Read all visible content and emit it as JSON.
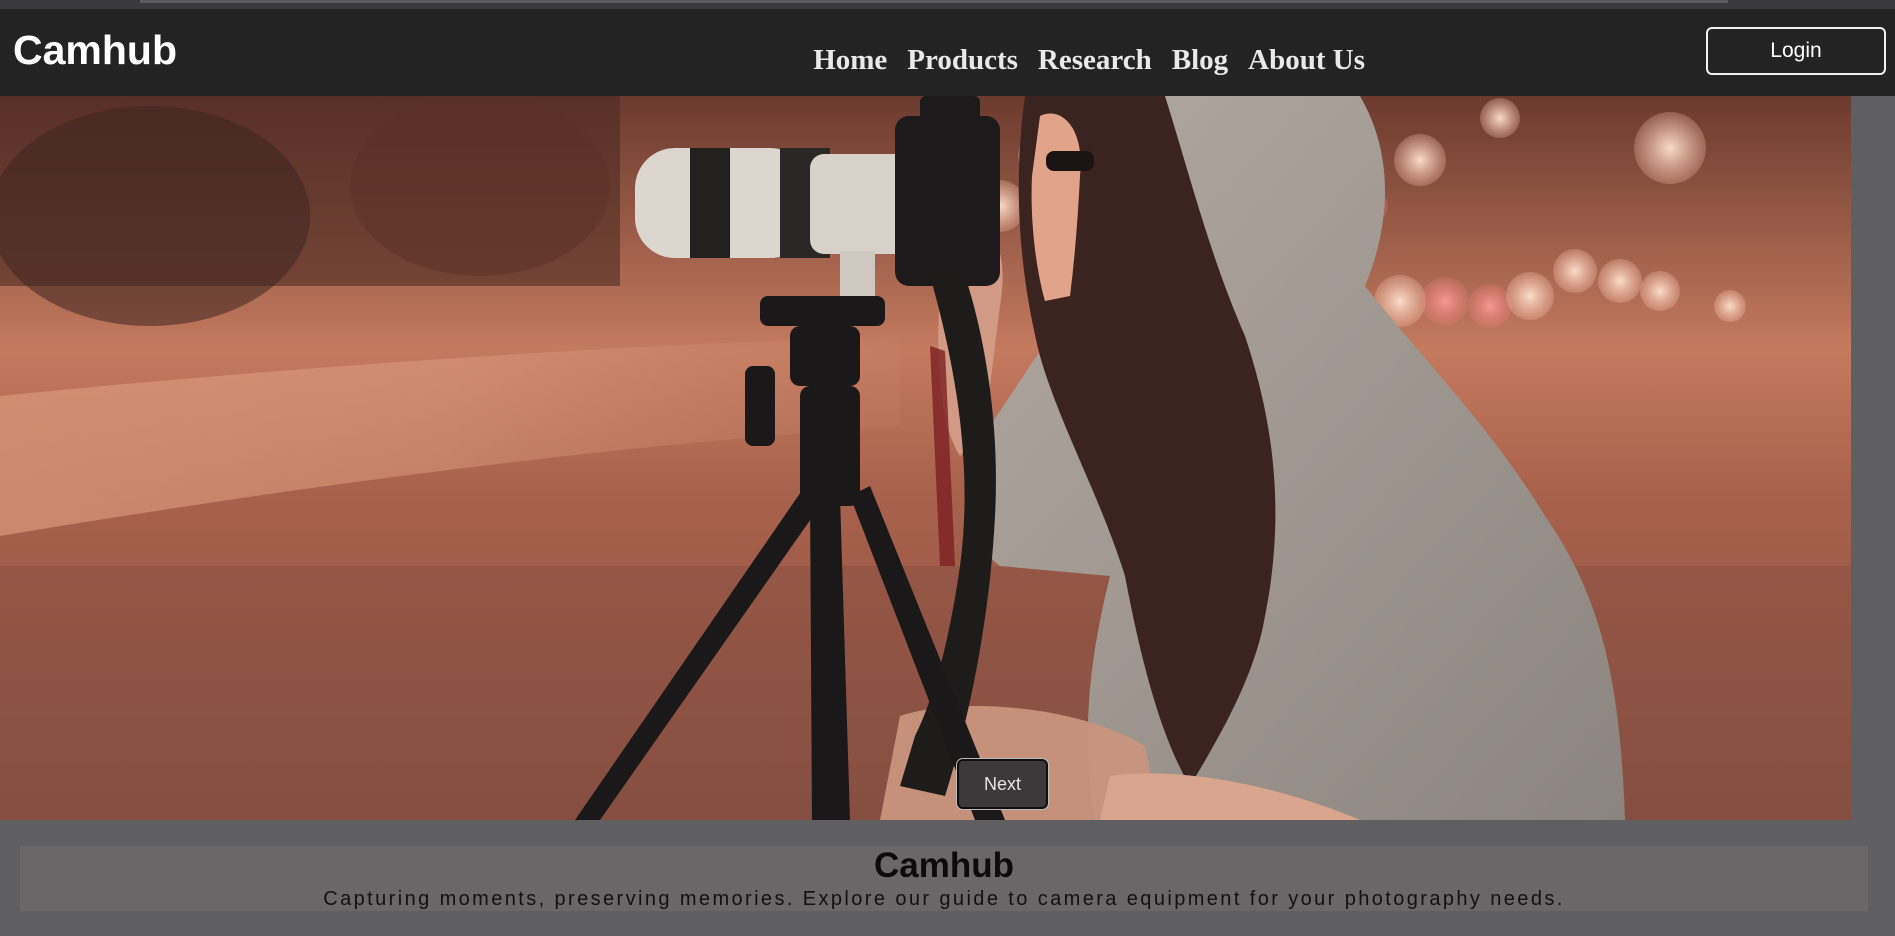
{
  "header": {
    "brand": "Camhub",
    "nav": [
      "Home",
      "Products",
      "Research",
      "Blog",
      "About Us"
    ],
    "login_label": "Login"
  },
  "hero": {
    "image": "photographer-with-camera-on-tripod",
    "next_label": "Next"
  },
  "footer": {
    "title": "Camhub",
    "tagline": "Capturing moments, preserving memories. Explore our guide to camera equipment for your photography needs."
  },
  "colors": {
    "navbar": "#242324",
    "page_bg": "#5f5e60",
    "footer_box": "#6a6768"
  }
}
